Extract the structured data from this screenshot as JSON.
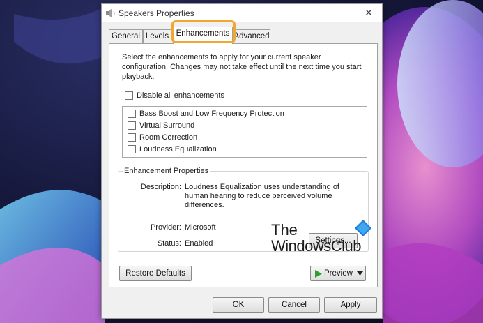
{
  "window": {
    "title": "Speakers Properties",
    "close_glyph": "✕"
  },
  "tabs": [
    {
      "label": "General"
    },
    {
      "label": "Levels"
    },
    {
      "label": "Enhancements",
      "active": true
    },
    {
      "label": "Advanced"
    }
  ],
  "intro_text": "Select the enhancements to apply for your current speaker configuration. Changes may not take effect until the next time you start playback.",
  "disable_all": {
    "label": "Disable all enhancements",
    "checked": false
  },
  "enhancements": [
    {
      "label": "Bass Boost and Low Frequency Protection",
      "checked": false
    },
    {
      "label": "Virtual Surround",
      "checked": false
    },
    {
      "label": "Room Correction",
      "checked": false
    },
    {
      "label": "Loudness Equalization",
      "checked": false
    }
  ],
  "properties": {
    "legend": "Enhancement Properties",
    "description_label": "Description:",
    "description_value": "Loudness Equalization uses understanding of human hearing to reduce perceived volume differences.",
    "provider_label": "Provider:",
    "provider_value": "Microsoft",
    "status_label": "Status:",
    "status_value": "Enabled",
    "settings_button": "Settings..."
  },
  "buttons": {
    "restore_defaults": "Restore Defaults",
    "preview": "Preview",
    "ok": "OK",
    "cancel": "Cancel",
    "apply": "Apply"
  },
  "watermark": {
    "line1": "The",
    "line2": "WindowsClub"
  },
  "colors": {
    "tab_highlight": "#f0a830",
    "provider_underline": "#d01818",
    "preview_play": "#2e9e2e"
  },
  "icons": [
    "speaker-icon",
    "close-icon",
    "play-icon",
    "dropdown-arrow-icon",
    "windows-club-logo-icon"
  ]
}
